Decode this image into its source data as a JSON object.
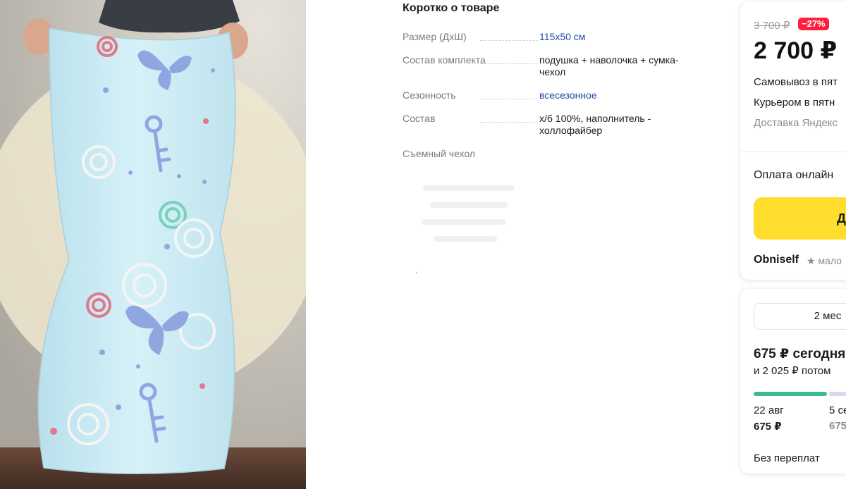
{
  "specs": {
    "title": "Коротко о товаре",
    "rows": [
      {
        "key": "Размер (ДхШ)",
        "value": "115х50 см"
      },
      {
        "key": "Состав комплекта",
        "value": "подушка + наволочка + сумка-чехол"
      },
      {
        "key": "Сезонность",
        "value": "всесезонное"
      },
      {
        "key": "Состав",
        "value": "х/б 100%, наполнитель - холлофайбер"
      },
      {
        "key": "Съемный чехол",
        "value": ""
      }
    ]
  },
  "buy_card": {
    "old_price": "3 700 ₽",
    "discount": "−27%",
    "price": "2 700 ₽",
    "delivery": [
      "Самовывоз в пят",
      "Курьером в пятн",
      "Доставка Яндекс"
    ],
    "payment": "Оплата онлайн",
    "cta_label": "Д",
    "seller": "Obniself",
    "seller_rating": "★ мало"
  },
  "split_card": {
    "term": "2 мес",
    "today": "675 ₽ сегодня",
    "later": "и 2 025 ₽ потом",
    "schedule": [
      {
        "date": "22 авг",
        "amount": "675 ₽"
      },
      {
        "date": "5 се",
        "amount": "675"
      }
    ],
    "no_overpay": "Без переплат"
  },
  "colors": {
    "accent_yellow": "#ffdd2d",
    "discount_red": "#ff1f3d",
    "link_blue": "#1d4e9e",
    "progress_green": "#3dbb8a"
  }
}
